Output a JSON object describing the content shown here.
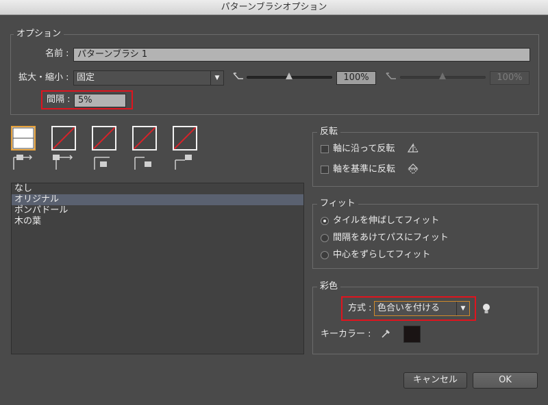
{
  "window": {
    "title": "パターンブラシオプション"
  },
  "options": {
    "legend": "オプション",
    "name_label": "名前 :",
    "name_value": "パターンブラシ 1",
    "scale_label": "拡大・縮小 :",
    "scale_value": "固定",
    "scale_min_pct": "100%",
    "scale_max_pct": "100%",
    "spacing_label": "間隔 :",
    "spacing_value": "5%"
  },
  "tiles": [
    {
      "name": "side-tile",
      "state": "selected"
    },
    {
      "name": "outer-corner-tile",
      "state": "none"
    },
    {
      "name": "inner-corner-tile",
      "state": "none"
    },
    {
      "name": "start-tile",
      "state": "none"
    },
    {
      "name": "end-tile",
      "state": "none"
    }
  ],
  "pattern_list": {
    "items": [
      "なし",
      "オリジナル",
      "ポンパドール",
      "木の葉"
    ],
    "selected_index": 1
  },
  "flip": {
    "legend": "反転",
    "along": "軸に沿って反転",
    "across": "軸を基準に反転"
  },
  "fit": {
    "legend": "フィット",
    "options": [
      "タイルを伸ばしてフィット",
      "間隔をあけてパスにフィット",
      "中心をずらしてフィット"
    ],
    "selected_index": 0
  },
  "colorization": {
    "legend": "彩色",
    "method_label": "方式 :",
    "method_value": "色合いを付ける",
    "key_color_label": "キーカラー :",
    "key_color": "#1a1414"
  },
  "buttons": {
    "cancel": "キャンセル",
    "ok": "OK"
  },
  "colors": {
    "accent_red": "#e0141e",
    "tile_slash": "#d8232a",
    "selected_tile_border": "#e8a33c"
  }
}
